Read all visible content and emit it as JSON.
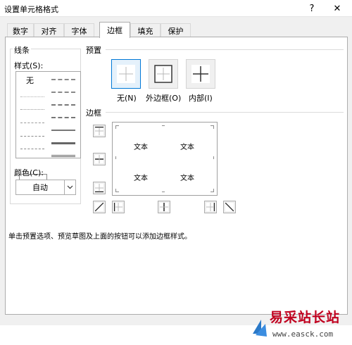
{
  "window": {
    "title": "设置单元格格式",
    "help_label": "?",
    "close_label": "✕"
  },
  "tabs": [
    {
      "label": "数字"
    },
    {
      "label": "对齐"
    },
    {
      "label": "字体"
    },
    {
      "label": "边框",
      "active": true
    },
    {
      "label": "填充"
    },
    {
      "label": "保护"
    }
  ],
  "line": {
    "group_label": "线条",
    "style_label": "样式(S):",
    "style_none_label": "无",
    "color_label": "颜色(C):",
    "color_value": "自动"
  },
  "presets": {
    "section_label": "预置",
    "items": [
      {
        "label": "无(N)",
        "icon": "preset-none-icon",
        "selected": true
      },
      {
        "label": "外边框(O)",
        "icon": "preset-outline-icon"
      },
      {
        "label": "内部(I)",
        "icon": "preset-inside-icon"
      }
    ]
  },
  "border": {
    "section_label": "边框",
    "preview_texts": [
      "文本",
      "文本",
      "文本",
      "文本"
    ]
  },
  "hint": "单击预置选项、预览草图及上面的按钮可以添加边框样式。",
  "watermark": {
    "title": "易采站长站",
    "url": "www.easck.com"
  },
  "colors": {
    "accent": "#0078d7",
    "watermark_red": "#c0001e"
  }
}
